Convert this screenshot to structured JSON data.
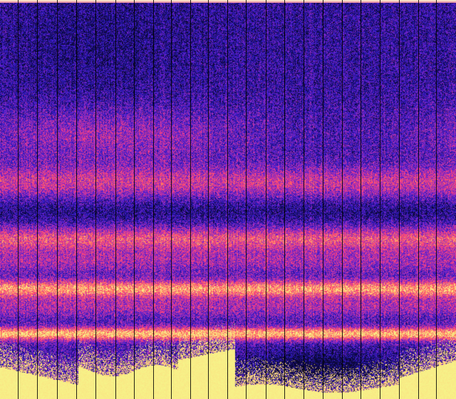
{
  "image": {
    "kind": "spectrogram-like heatmap",
    "colormap": [
      "#0b0830",
      "#1a0f8a",
      "#3a1fd0",
      "#7a22c8",
      "#c23aa8",
      "#ff3a7a",
      "#ff7a5a",
      "#ffd07a",
      "#f6f58a"
    ],
    "background": "#f6f58a",
    "gridline_color": "#000000"
  }
}
